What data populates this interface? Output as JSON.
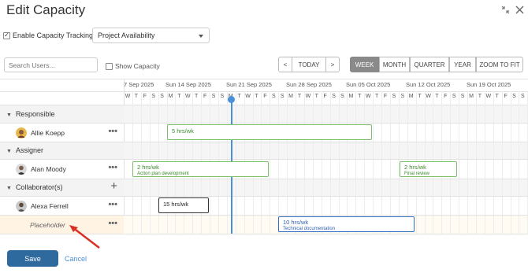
{
  "window": {
    "title": "Edit Capacity",
    "collapse_icon": "collapse-icon",
    "close_icon": "close-icon"
  },
  "toolbar": {
    "enable_tracking_label": "Enable Capacity Tracking",
    "enable_tracking_checked": true,
    "availability_select": "Project Availability",
    "search_placeholder": "Search Users...",
    "show_capacity_label": "Show Capacity",
    "show_capacity_checked": false,
    "prev_label": "<",
    "today_label": "TODAY",
    "next_label": ">",
    "views": [
      "WEEK",
      "MONTH",
      "QUARTER",
      "YEAR",
      "ZOOM TO FIT"
    ],
    "active_view": "WEEK"
  },
  "timeline": {
    "weeks": [
      "7 Sep 2025",
      "Sun 14 Sep 2025",
      "Sun 21 Sep 2025",
      "Sun 28 Sep 2025",
      "Sun 05 Oct 2025",
      "Sun 12 Oct 2025",
      "Sun 19 Oct 2025"
    ],
    "days": [
      "W",
      "T",
      "F",
      "S",
      "S",
      "M",
      "T",
      "W",
      "T",
      "F",
      "S",
      "S",
      "M",
      "T",
      "W",
      "T",
      "F",
      "S",
      "S",
      "M",
      "T",
      "W",
      "T",
      "F",
      "S",
      "S",
      "M",
      "T",
      "W",
      "T",
      "F",
      "S",
      "S",
      "M",
      "T",
      "W",
      "T",
      "F",
      "S",
      "S",
      "M",
      "T",
      "W",
      "T",
      "F",
      "S",
      "S",
      "M"
    ]
  },
  "groups": [
    {
      "label": "Responsible",
      "rows": [
        {
          "name": "Allie Koepp",
          "more": "•••"
        }
      ]
    },
    {
      "label": "Assigner",
      "rows": [
        {
          "name": "Alan Moody",
          "more": "•••"
        }
      ]
    },
    {
      "label": "Collaborator(s)",
      "add": "+",
      "rows": [
        {
          "name": "Alexa Ferrell",
          "more": "•••"
        },
        {
          "name": "Placeholder",
          "more": "•••"
        }
      ]
    }
  ],
  "bars": {
    "allie": {
      "title": "5 hrs/wk",
      "color": "#7cbf6a"
    },
    "alan_1": {
      "title": "2 hrs/wk",
      "sub": "Action plan development",
      "color": "#7cbf6a"
    },
    "alan_2": {
      "title": "2 hrs/wk",
      "sub": "Final review",
      "color": "#7cbf6a"
    },
    "alexa": {
      "title": "15 hrs/wk",
      "color": "#333333"
    },
    "placeholder": {
      "title": "10 hrs/wk",
      "sub": "Technical documentation",
      "color": "#2f6fc4"
    }
  },
  "footer": {
    "save_label": "Save",
    "cancel_label": "Cancel"
  },
  "colors": {
    "accent": "#2f6a9e",
    "today_line": "#4a90d9",
    "annotation_arrow": "#d93025"
  }
}
